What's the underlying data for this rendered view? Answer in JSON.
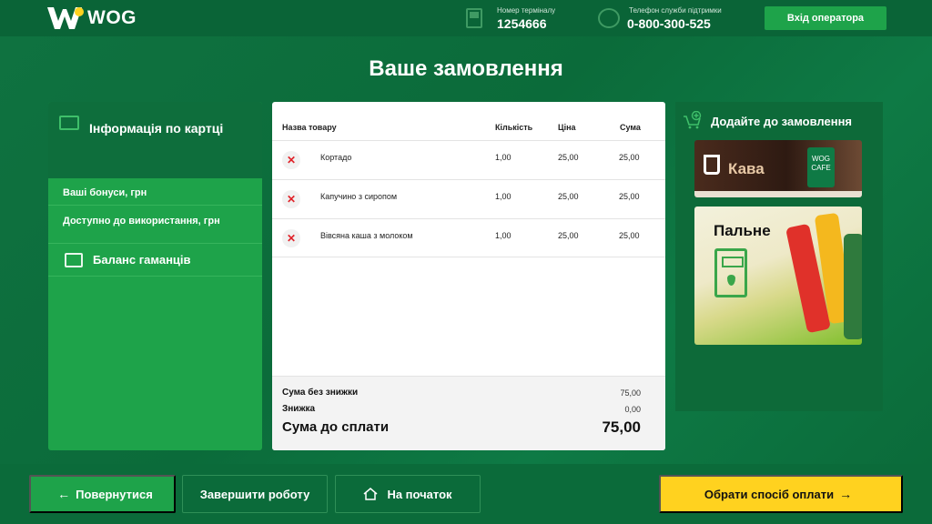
{
  "header": {
    "logo_text": "WOG",
    "terminal_label": "Номер терміналу",
    "terminal_number": "1254666",
    "support_label": "Телефон служби підтримки",
    "support_phone": "0-800-300-525",
    "operator_button": "Вхід оператора"
  },
  "page_title": "Ваше замовлення",
  "card_panel": {
    "title": "Інформація по картці",
    "bonuses_label": "Ваші бонуси, грн",
    "available_label": "Доступно до використання, грн",
    "wallet_label": "Баланс гаманців"
  },
  "order": {
    "columns": [
      "Назва товару",
      "Кількість",
      "Ціна",
      "Сума"
    ],
    "rows": [
      {
        "name": "Кортадо",
        "qty": "1,00",
        "price": "25,00",
        "sum": "25,00"
      },
      {
        "name": "Капучино з сиропом",
        "qty": "1,00",
        "price": "25,00",
        "sum": "25,00"
      },
      {
        "name": "Вівсяна каша з молоком",
        "qty": "1,00",
        "price": "25,00",
        "sum": "25,00"
      }
    ],
    "subtotal_label": "Сума без знижки",
    "subtotal_value": "75,00",
    "discount_label": "Знижка",
    "discount_value": "0,00",
    "total_label": "Сума до сплати",
    "total_value": "75,00"
  },
  "addons": {
    "title": "Додайте до замовлення",
    "coffee_label": "Кава",
    "coffee_brand": "WOG CAFE",
    "fuel_label": "Пальне"
  },
  "footer": {
    "back_label": "Повернутися",
    "finish_label": "Завершити роботу",
    "home_label": "На початок",
    "pay_label": "Обрати спосіб оплати"
  },
  "colors": {
    "brand_green": "#0b6b3a",
    "accent_green": "#1ea34a",
    "pay_yellow": "#ffd21f",
    "remove_red": "#e0232a"
  }
}
